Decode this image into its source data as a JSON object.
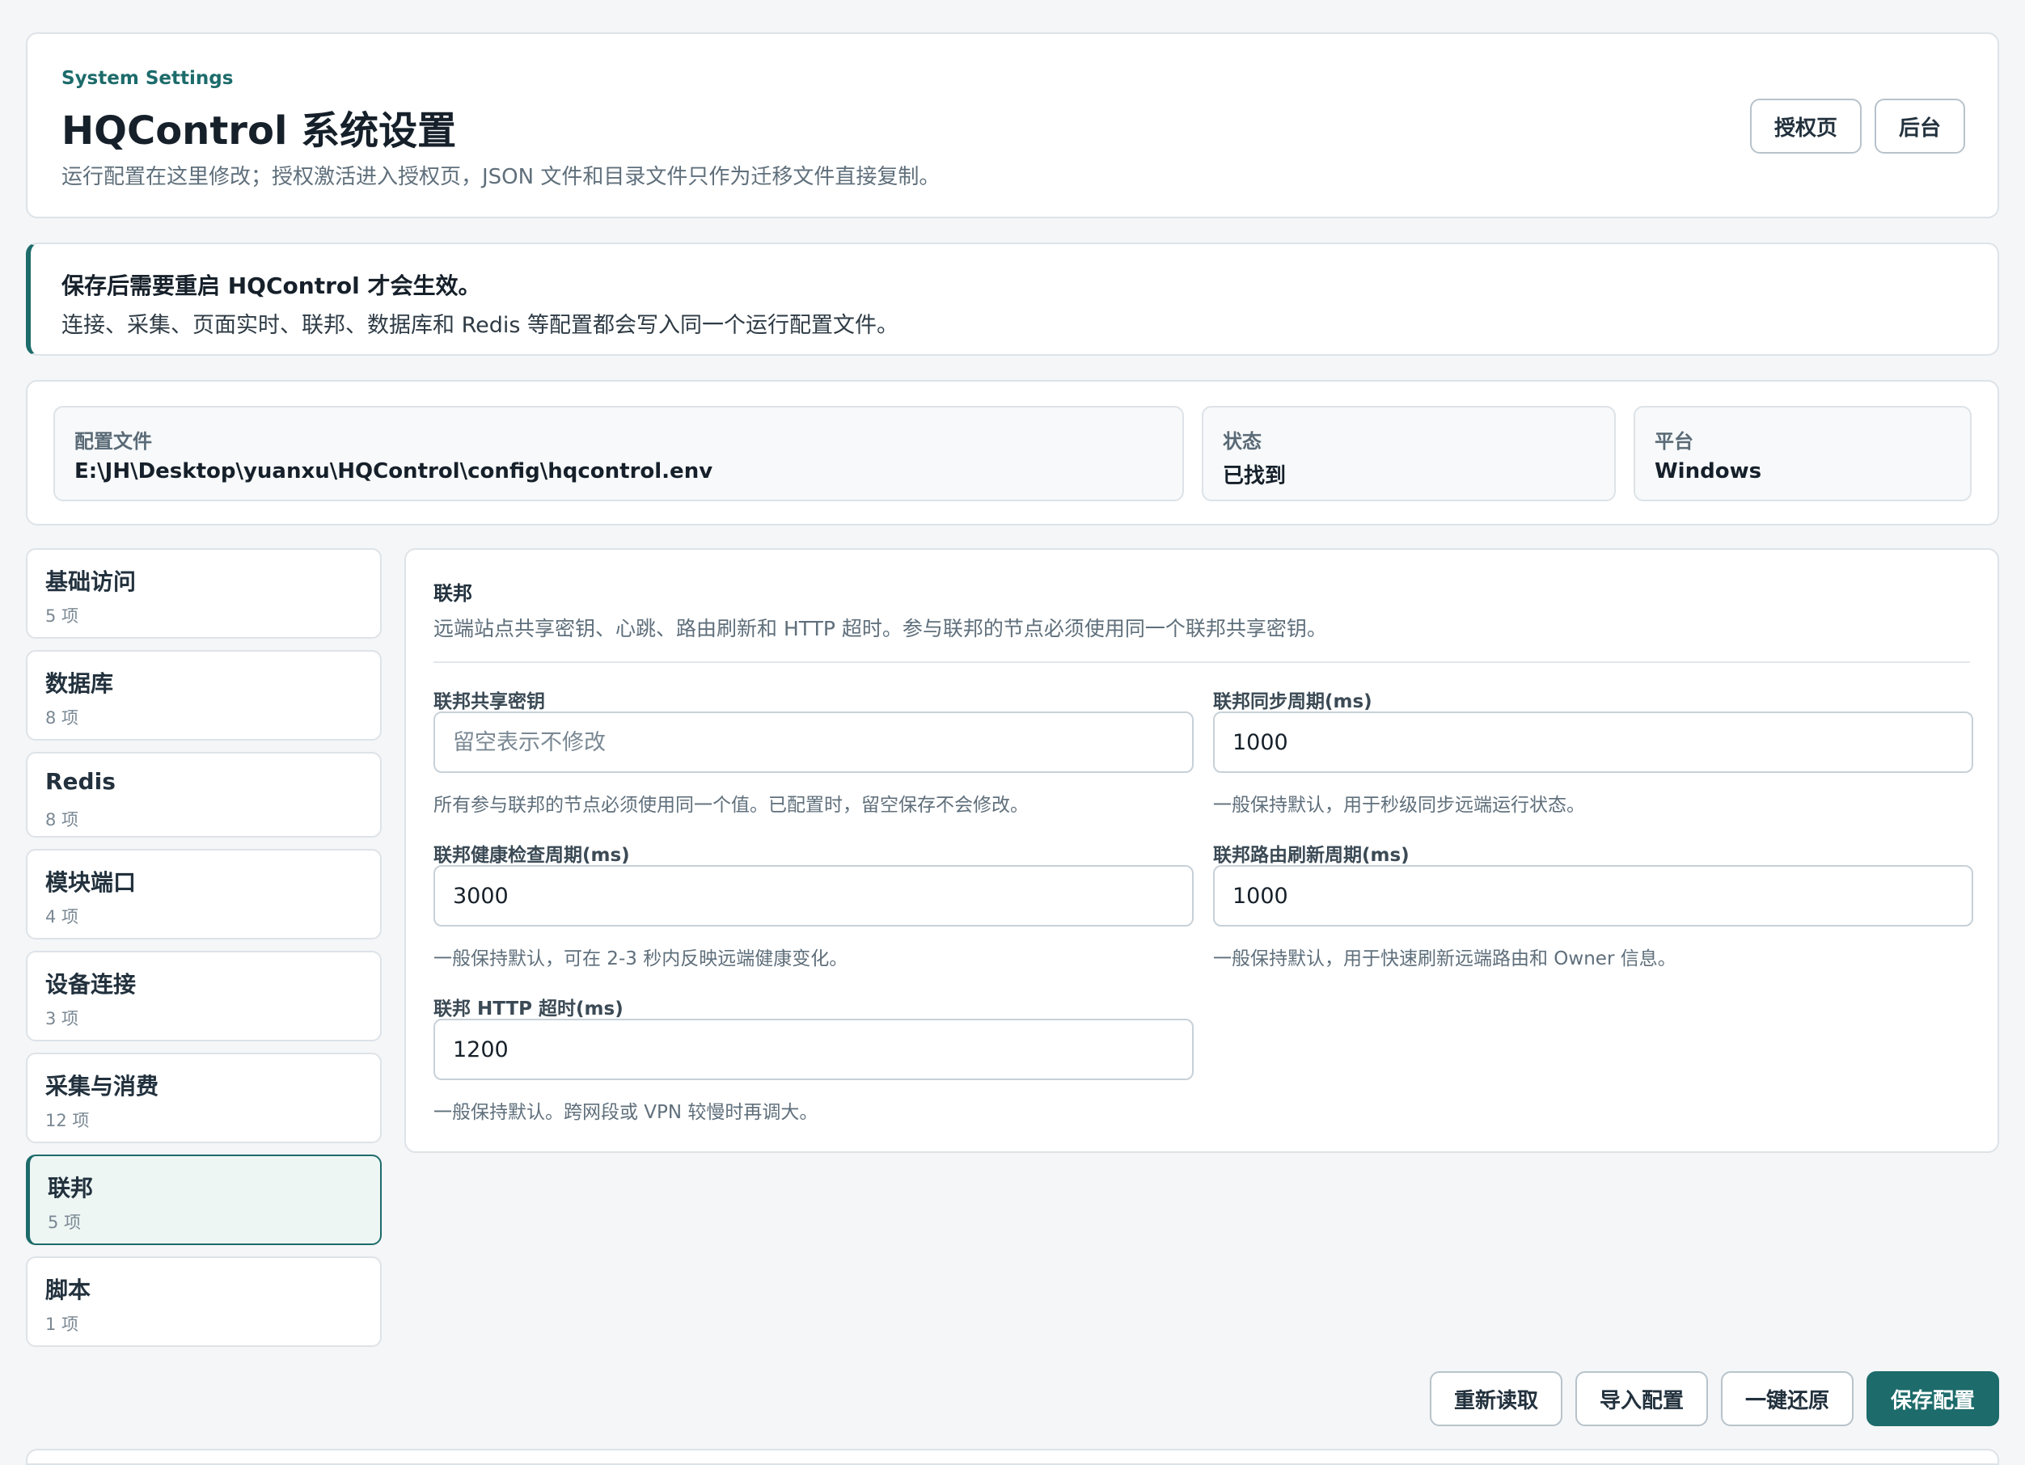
{
  "header": {
    "eyebrow": "System Settings",
    "title": "HQControl 系统设置",
    "subtitle": "运行配置在这里修改；授权激活进入授权页，JSON 文件和目录文件只作为迁移文件直接复制。",
    "auth_button": "授权页",
    "admin_button": "后台"
  },
  "notice": {
    "title": "保存后需要重启 HQControl 才会生效。",
    "body": "连接、采集、页面实时、联邦、数据库和 Redis 等配置都会写入同一个运行配置文件。"
  },
  "info": {
    "config_label": "配置文件",
    "config_value": "E:\\JH\\Desktop\\yuanxu\\HQControl\\config\\hqcontrol.env",
    "status_label": "状态",
    "status_value": "已找到",
    "platform_label": "平台",
    "platform_value": "Windows"
  },
  "sidebar": {
    "items": [
      {
        "label": "基础访问",
        "count": "5 项"
      },
      {
        "label": "数据库",
        "count": "8 项"
      },
      {
        "label": "Redis",
        "count": "8 项"
      },
      {
        "label": "模块端口",
        "count": "4 项"
      },
      {
        "label": "设备连接",
        "count": "3 项"
      },
      {
        "label": "采集与消费",
        "count": "12 项"
      },
      {
        "label": "联邦",
        "count": "5 项"
      },
      {
        "label": "脚本",
        "count": "1 项"
      }
    ],
    "active_index": 6
  },
  "panel": {
    "title": "联邦",
    "description": "远端站点共享密钥、心跳、路由刷新和 HTTP 超时。参与联邦的节点必须使用同一个联邦共享密钥。",
    "fields": [
      {
        "label": "联邦共享密钥",
        "value": "",
        "placeholder": "留空表示不修改",
        "hint": "所有参与联邦的节点必须使用同一个值。已配置时，留空保存不会修改。"
      },
      {
        "label": "联邦同步周期(ms)",
        "value": "1000",
        "placeholder": "",
        "hint": "一般保持默认，用于秒级同步远端运行状态。"
      },
      {
        "label": "联邦健康检查周期(ms)",
        "value": "3000",
        "placeholder": "",
        "hint": "一般保持默认，可在 2-3 秒内反映远端健康变化。"
      },
      {
        "label": "联邦路由刷新周期(ms)",
        "value": "1000",
        "placeholder": "",
        "hint": "一般保持默认，用于快速刷新远端路由和 Owner 信息。"
      },
      {
        "label": "联邦 HTTP 超时(ms)",
        "value": "1200",
        "placeholder": "",
        "hint": "一般保持默认。跨网段或 VPN 较慢时再调大。"
      }
    ]
  },
  "footer": {
    "reload": "重新读取",
    "import": "导入配置",
    "reset": "一键还原",
    "save": "保存配置"
  },
  "colors": {
    "accent": "#1d6b6b",
    "background": "#f4f6f8",
    "border": "#dde3e8"
  }
}
